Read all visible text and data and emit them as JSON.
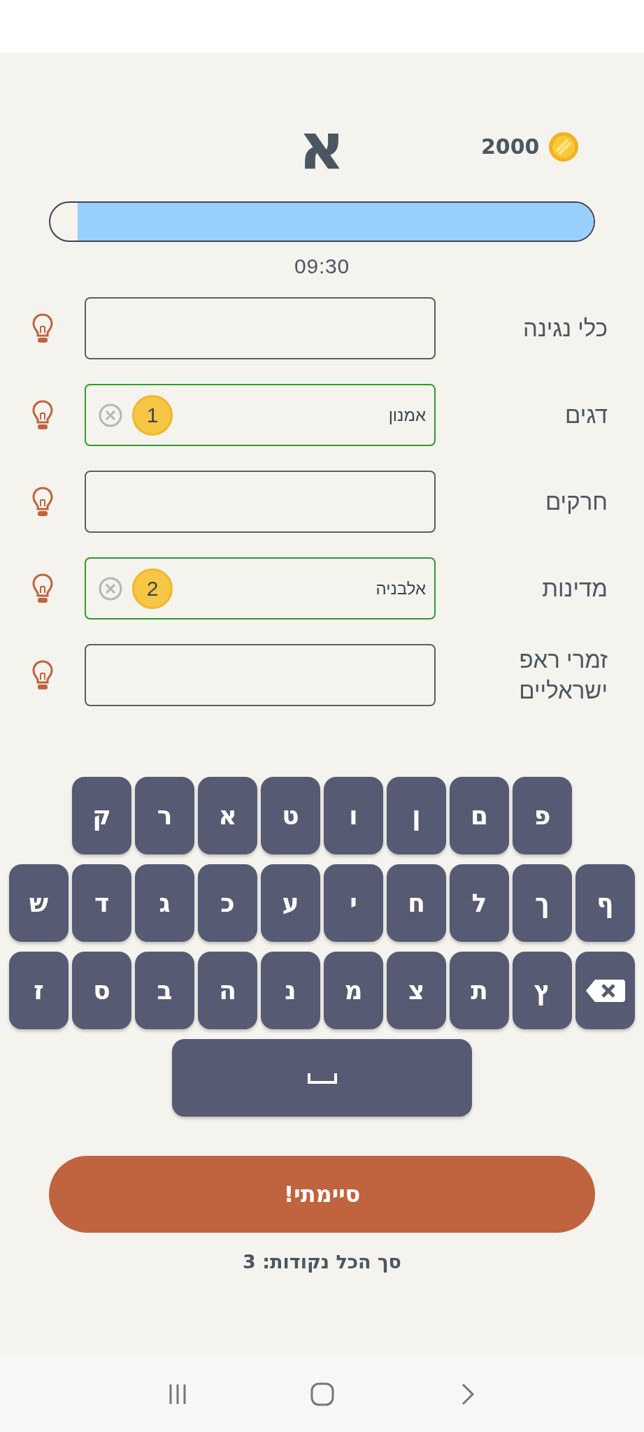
{
  "letter": "א",
  "coins": "2000",
  "timer": {
    "level": 0.95,
    "time": "09:30"
  },
  "categories": [
    {
      "label": "כלי נגינה",
      "correct": false
    },
    {
      "label": "דגים",
      "correct": true,
      "value": "אמנון",
      "points": "1"
    },
    {
      "label": "חרקים",
      "correct": false
    },
    {
      "label": "מדינות",
      "correct": true,
      "value": "אלבניה",
      "points": "2"
    },
    {
      "label": "זמרי ראפ ישראליים",
      "correct": false
    }
  ],
  "keyboard": [
    [
      {
        "kind": "letter",
        "char": "פ"
      },
      {
        "kind": "letter",
        "char": "ם"
      },
      {
        "kind": "letter",
        "char": "ן"
      },
      {
        "kind": "letter",
        "char": "ו"
      },
      {
        "kind": "letter",
        "char": "ט"
      },
      {
        "kind": "letter",
        "char": "א"
      },
      {
        "kind": "letter",
        "char": "ר"
      },
      {
        "kind": "letter",
        "char": "ק"
      }
    ],
    [
      {
        "kind": "letter",
        "char": "ף"
      },
      {
        "kind": "letter",
        "char": "ך"
      },
      {
        "kind": "letter",
        "char": "ל"
      },
      {
        "kind": "letter",
        "char": "ח"
      },
      {
        "kind": "letter",
        "char": "י"
      },
      {
        "kind": "letter",
        "char": "ע"
      },
      {
        "kind": "letter",
        "char": "כ"
      },
      {
        "kind": "letter",
        "char": "ג"
      },
      {
        "kind": "letter",
        "char": "ד"
      },
      {
        "kind": "letter",
        "char": "ש"
      }
    ],
    [
      {
        "kind": "backspace"
      },
      {
        "kind": "letter",
        "char": "ץ"
      },
      {
        "kind": "letter",
        "char": "ת"
      },
      {
        "kind": "letter",
        "char": "צ"
      },
      {
        "kind": "letter",
        "char": "מ"
      },
      {
        "kind": "letter",
        "char": "נ"
      },
      {
        "kind": "letter",
        "char": "ה"
      },
      {
        "kind": "letter",
        "char": "ב"
      },
      {
        "kind": "letter",
        "char": "ס"
      },
      {
        "kind": "letter",
        "char": "ז"
      }
    ],
    [
      {
        "kind": "space"
      }
    ]
  ],
  "done_button": "סיימתי!",
  "total": "סך הכל נקודות: 3"
}
